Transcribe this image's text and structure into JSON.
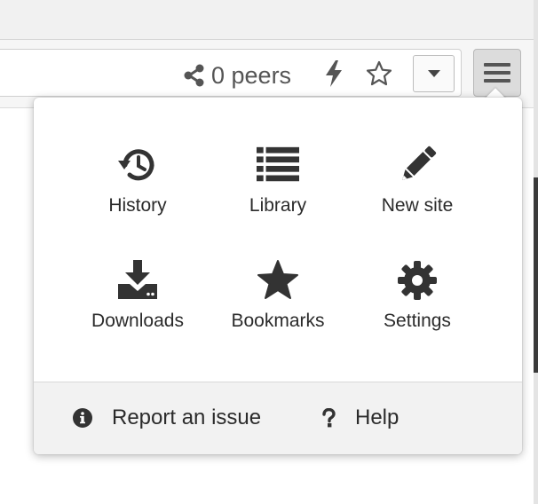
{
  "toolbar": {
    "peers_label": "0 peers",
    "icons": [
      "share-nodes-icon",
      "bolt-icon",
      "star-outline-icon",
      "caret-down-icon",
      "hamburger-icon"
    ]
  },
  "menu": {
    "items": [
      {
        "label": "History",
        "icon": "history-icon"
      },
      {
        "label": "Library",
        "icon": "library-list-icon"
      },
      {
        "label": "New site",
        "icon": "pencil-icon"
      },
      {
        "label": "Downloads",
        "icon": "download-icon"
      },
      {
        "label": "Bookmarks",
        "icon": "star-icon"
      },
      {
        "label": "Settings",
        "icon": "gear-icon"
      }
    ],
    "footer": [
      {
        "label": "Report an issue",
        "icon": "info-circle-icon"
      },
      {
        "label": "Help",
        "icon": "question-icon"
      }
    ]
  },
  "colors": {
    "icon": "#333333",
    "panel_bg": "#ffffff",
    "footer_bg": "#f2f2f2",
    "toolbar_bg": "#f6f6f6",
    "hamburger_active_bg": "#dcdcdc"
  }
}
